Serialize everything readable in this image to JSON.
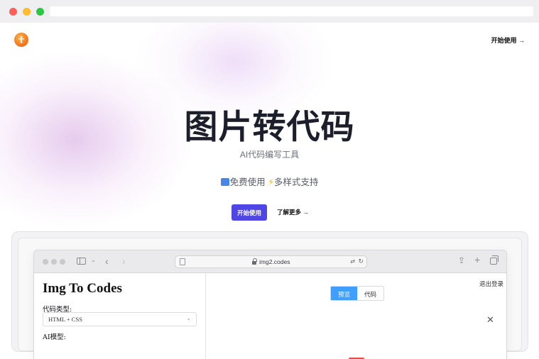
{
  "browser": {
    "controls": [
      "close",
      "minimize",
      "maximize"
    ]
  },
  "header": {
    "logo_icon": "orange-person-logo-icon",
    "nav_start": "开始使用 →"
  },
  "hero": {
    "title": "图片转代码",
    "subtitle": "AI代码编写工具",
    "features": {
      "free": "免费使用",
      "styles": "多样式支持",
      "free_icon": "new-badge-icon",
      "styles_icon": "lightning-icon"
    },
    "primary_button": "开始使用",
    "learn_more": "了解更多 →"
  },
  "showcase": {
    "browser": {
      "url": "img2.codes"
    },
    "app": {
      "title": "Img To Codes",
      "code_type_label": "代码类型:",
      "code_type_value": "HTML + CSS",
      "model_label": "AI模型:",
      "logout": "退出登录",
      "tabs": [
        {
          "label": "预览",
          "active": true
        },
        {
          "label": "代码",
          "active": false
        }
      ]
    }
  },
  "colors": {
    "primary": "#4f46e5",
    "tab_active": "#409eff",
    "logo": "#f36f16"
  }
}
